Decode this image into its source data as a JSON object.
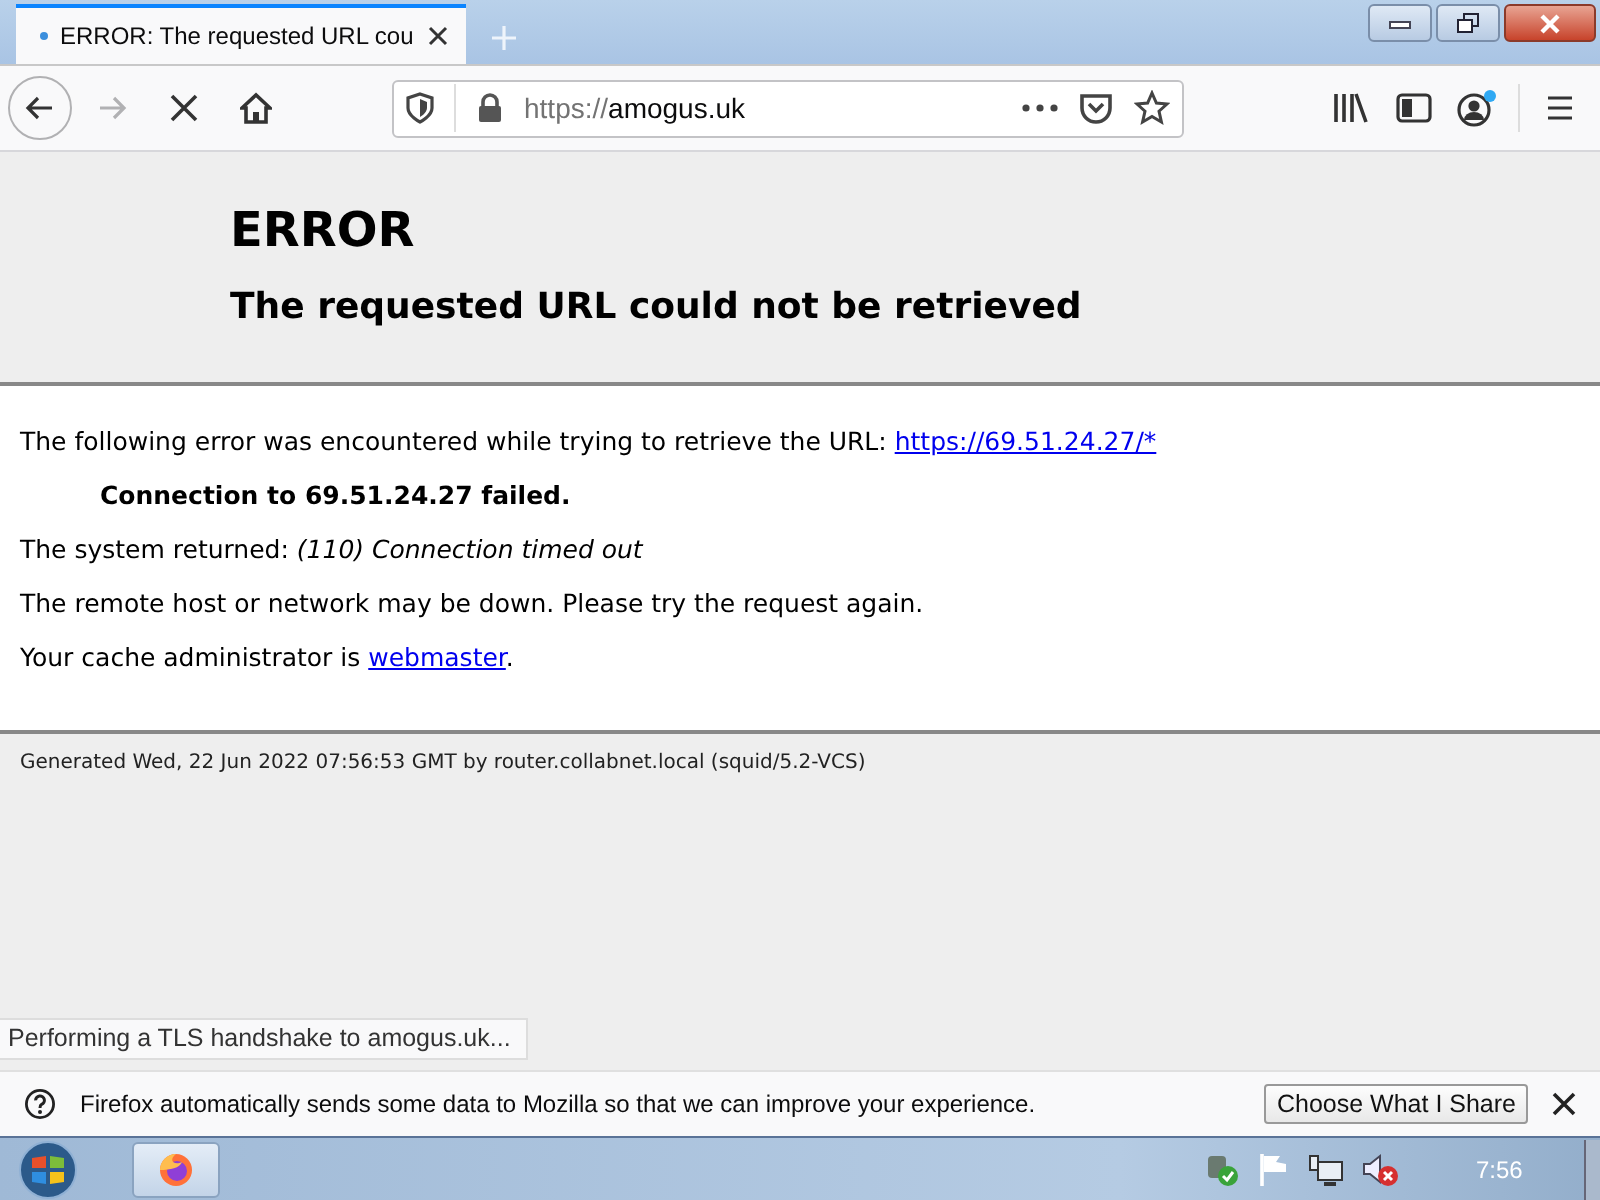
{
  "tab": {
    "title": "ERROR: The requested URL cou",
    "selected": true,
    "loading": true
  },
  "toolbar": {
    "forward_disabled": true,
    "loading": true,
    "url_scheme": "https://",
    "url_host": "amogus.uk",
    "account_badge": true
  },
  "page": {
    "heading": "ERROR",
    "subheading": "The requested URL could not be retrieved",
    "paragraphs": [
      {
        "kind": "link",
        "text": "The following error was encountered while trying to retrieve the URL: ",
        "link": "https://69.51.24.27/*"
      },
      {
        "kind": "strong",
        "text": "Connection to 69.51.24.27 failed."
      },
      {
        "kind": "plain",
        "text": "The system returned: *(110) Connection timed out*"
      },
      {
        "kind": "plain",
        "text": "The remote host or network may be down. Please try the request again."
      },
      {
        "kind": "link",
        "text": "Your cache administrator is ",
        "link": "webmaster",
        "after": "."
      }
    ],
    "footer": "Generated Wed, 22 Jun 2022 07:56:53 GMT by router.collabnet.local (squid/5.2-VCS)"
  },
  "status": "Performing a TLS handshake to amogus.uk...",
  "notification": {
    "message": "Firefox automatically sends some data to Mozilla so that we can improve your experience.",
    "button": "Choose What I Share"
  },
  "taskbar": {
    "clock": "7:56"
  }
}
